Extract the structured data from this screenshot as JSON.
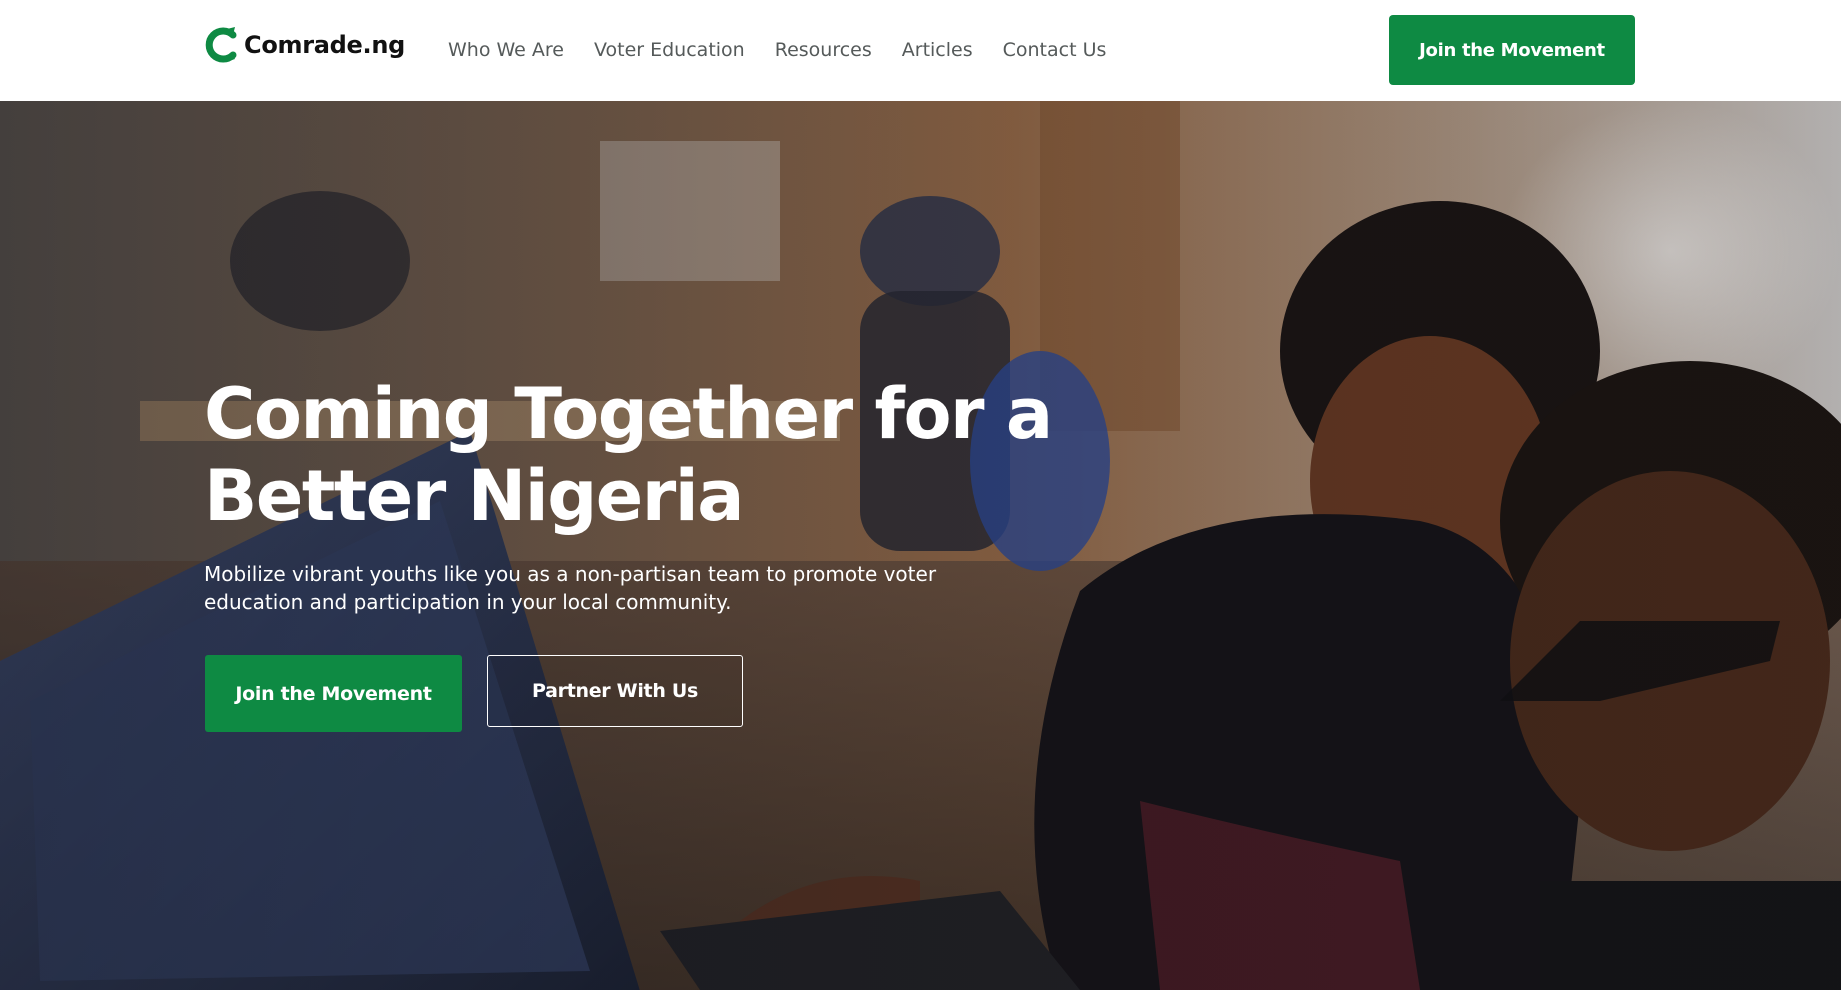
{
  "brand": {
    "logo_icon": "comrade-c-logo-icon",
    "name": "Comrade.ng",
    "color": "#0e8a43"
  },
  "nav": {
    "items": [
      {
        "label": "Who We Are"
      },
      {
        "label": "Voter Education"
      },
      {
        "label": "Resources"
      },
      {
        "label": "Articles"
      },
      {
        "label": "Contact Us"
      }
    ]
  },
  "header": {
    "cta_label": "Join the Movement"
  },
  "hero": {
    "background": "photo-two-people-at-laptop-in-office",
    "title": "Coming Together for a Better Nigeria",
    "subtitle": "Mobilize vibrant youths like you as a non-partisan team to promote voter education and participation in your local community.",
    "primary_cta": "Join the Movement",
    "secondary_cta": "Partner With Us"
  }
}
